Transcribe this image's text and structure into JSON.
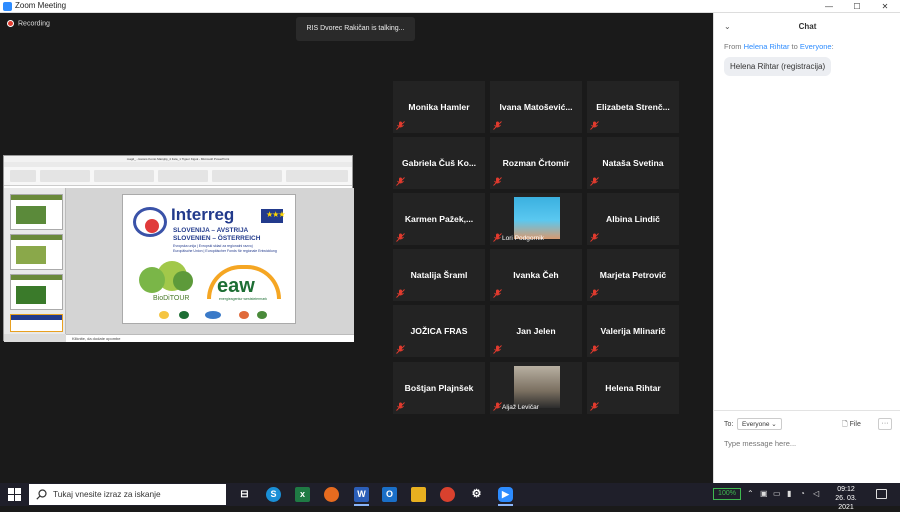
{
  "window": {
    "title": "Zoom Meeting",
    "min": "—",
    "max": "☐",
    "close": "✕"
  },
  "recording": {
    "label": "Recording"
  },
  "talking_banner": "RIS Dvorec Rakičan is talking...",
  "shared_screen": {
    "app_title": "mag2_...lssions Konto Marsjitp_4 Fela_1 Tigsor Kigok - Microsoft PowerPoint",
    "notes_text": "Kliknite, da dodate opombe",
    "slide": {
      "logo": "Interreg",
      "line1": "SLOVENIJA – AVSTRIJA",
      "line2": "SLOVENIEN – ÖSTERREICH",
      "small1": "Evropska unija | Evropski sklad za regionalni razvoj",
      "small2": "Europäische Union | Europäischer Fonds für regionale Entwicklung",
      "project": "BioDiTOUR",
      "partner": "eaw",
      "partner_sub": "energieagentur weststeiermark",
      "eu_stars": "★★★"
    }
  },
  "gallery": [
    {
      "name": "Monika Hamler"
    },
    {
      "name": "Ivana Matošević..."
    },
    {
      "name": "Elizabeta Strenč..."
    },
    {
      "name": "Gabriela Čuš Ko..."
    },
    {
      "name": "Rozman Črtomir"
    },
    {
      "name": "Nataša Svetina"
    },
    {
      "name": "Karmen Pažek,..."
    },
    {
      "name": "Lori Podgornik",
      "video": true
    },
    {
      "name": "Albina Lindič"
    },
    {
      "name": "Natalija Šraml"
    },
    {
      "name": "Ivanka Čeh"
    },
    {
      "name": "Marjeta Petrovič"
    },
    {
      "name": "JOŽICA FRAS"
    },
    {
      "name": "Jan Jelen"
    },
    {
      "name": "Valerija Mlinarič"
    },
    {
      "name": "Boštjan Plajnšek"
    },
    {
      "name": "Aljaž Levičar",
      "video": true
    },
    {
      "name": "Helena Rihtar"
    }
  ],
  "chat": {
    "title": "Chat",
    "collapse": "⌄",
    "from_label": "From",
    "sender": "Helena Rihtar",
    "to_word": "to",
    "recipient": "Everyone",
    "message": "Helena Rihtar (registracija)",
    "to_label": "To:",
    "to_value": "Everyone",
    "file_label": "File",
    "more": "···",
    "placeholder": "Type message here..."
  },
  "taskbar": {
    "search_placeholder": "Tukaj vnesite izraz za iskanje",
    "battery": "100%",
    "time": "09:12",
    "date": "26. 03. 2021"
  },
  "colors": {
    "accent": "#2d8cff",
    "muted": "#e23b2e"
  }
}
